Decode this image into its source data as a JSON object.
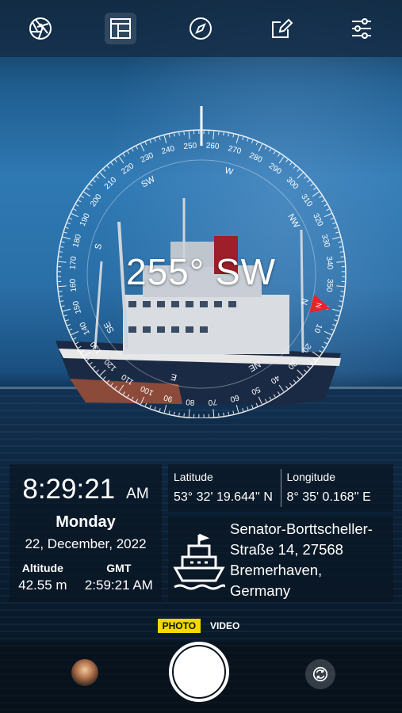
{
  "toolbar": {
    "icons": [
      "aperture-icon",
      "layout-icon",
      "compass-icon",
      "edit-icon",
      "sliders-icon"
    ],
    "active": "layout-icon"
  },
  "compass": {
    "heading": "255° SW",
    "degree_labels": [
      "0",
      "10",
      "20",
      "30",
      "40",
      "50",
      "60",
      "70",
      "80",
      "90",
      "100",
      "110",
      "120",
      "130",
      "140",
      "150",
      "160",
      "170",
      "180",
      "190",
      "200",
      "210",
      "220",
      "230",
      "240",
      "250",
      "260",
      "270",
      "280",
      "290",
      "300",
      "310",
      "320",
      "330",
      "340",
      "350"
    ],
    "cardinals": {
      "N": "N",
      "NE": "NE",
      "E": "E",
      "SE": "SE",
      "S": "S",
      "SW": "SW",
      "W": "W",
      "NW": "NW"
    },
    "north_marker_color": "#e8232a"
  },
  "time_panel": {
    "time": "8:29:21",
    "ampm": "AM",
    "day": "Monday",
    "date": "22, December, 2022",
    "altitude_label": "Altitude",
    "altitude_value": "42.55 m",
    "gmt_label": "GMT",
    "gmt_value": "2:59:21 AM"
  },
  "coords": {
    "latitude_label": "Latitude",
    "latitude_value": "53° 32' 19.644'' N",
    "longitude_label": "Longitude",
    "longitude_value": "8° 35' 0.168'' E"
  },
  "address": {
    "line1": "Senator-Borttscheller-",
    "line2": "Straße 14, 27568",
    "line3": "Bremerhaven,",
    "line4": "Germany",
    "icon": "ship-icon"
  },
  "modes": {
    "photo": "PHOTO",
    "video": "VIDEO",
    "active": "photo",
    "accent": "#f5d800"
  },
  "bottom": {
    "thumbnail_icon": "gallery-thumbnail",
    "shutter_icon": "shutter-button",
    "switch_icon": "camera-switch-icon"
  }
}
